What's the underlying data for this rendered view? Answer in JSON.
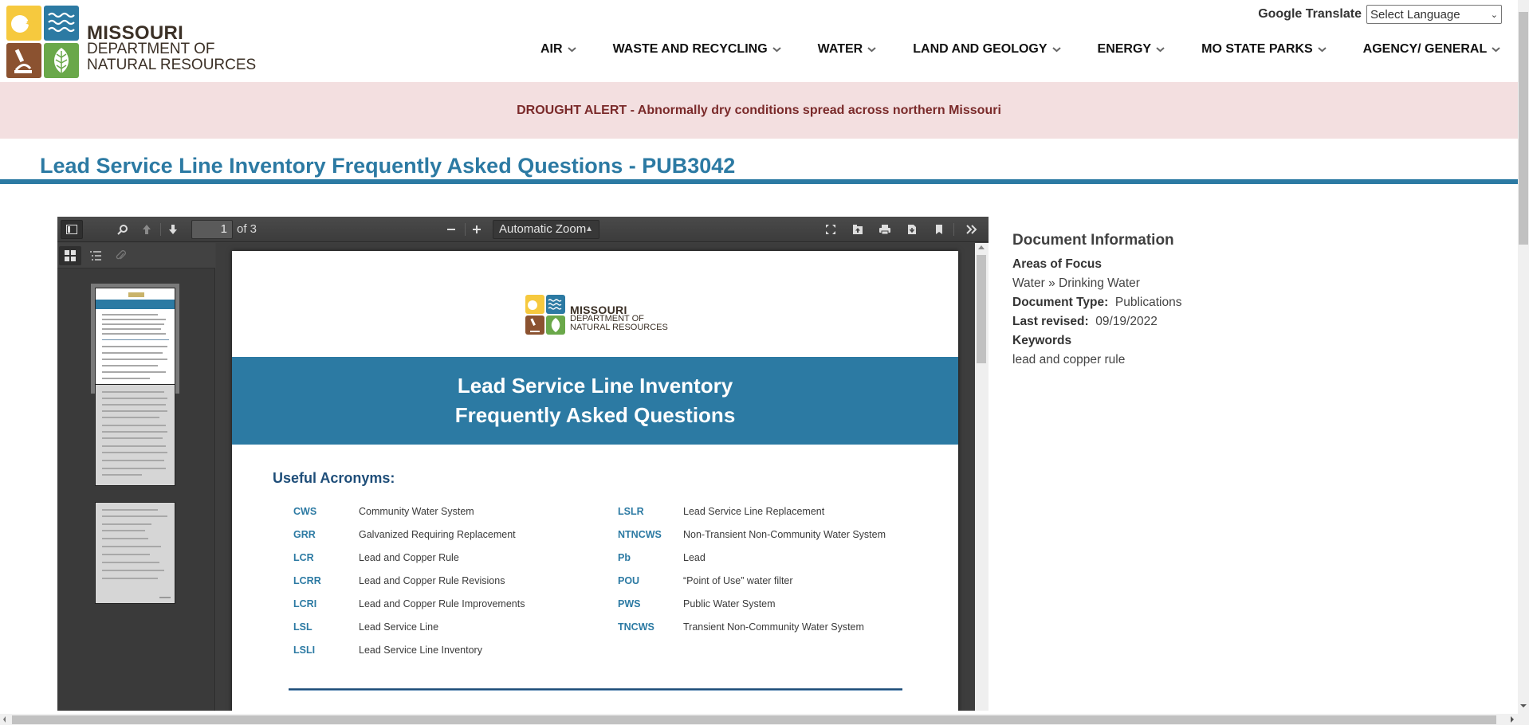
{
  "header": {
    "logo": {
      "line1": "MISSOURI",
      "line2": "DEPARTMENT OF",
      "line3": "NATURAL RESOURCES"
    },
    "translate": {
      "label": "Google Translate",
      "selected": "Select Language"
    },
    "nav": [
      {
        "label": "AIR"
      },
      {
        "label": "WASTE AND RECYCLING"
      },
      {
        "label": "WATER"
      },
      {
        "label": "LAND AND GEOLOGY"
      },
      {
        "label": "ENERGY"
      },
      {
        "label": "MO STATE PARKS"
      },
      {
        "label": "AGENCY/ GENERAL"
      }
    ]
  },
  "alert": {
    "text": "DROUGHT ALERT - Abnormally dry conditions spread across northern Missouri"
  },
  "page": {
    "title": "Lead Service Line Inventory Frequently Asked Questions - PUB3042"
  },
  "viewer": {
    "current_page": "1",
    "page_count_label": "of 3",
    "zoom": "Automatic Zoom",
    "icons": {
      "sidebar_toggle": "sidebar-toggle-icon",
      "find": "search-icon",
      "previous": "arrow-up-icon",
      "next": "arrow-down-icon",
      "zoom_out": "minus-icon",
      "zoom_in": "plus-icon",
      "presentation": "fullscreen-icon",
      "open": "open-file-icon",
      "print": "print-icon",
      "download": "download-icon",
      "bookmark": "bookmark-icon",
      "tools": "double-chevron-right-icon"
    },
    "sidebar_tabs": [
      "thumbnails-icon",
      "outline-icon",
      "attachments-icon"
    ],
    "thumbnails": [
      {
        "page": 1,
        "selected": true
      },
      {
        "page": 2,
        "selected": false
      },
      {
        "page": 3,
        "selected": false
      }
    ],
    "pdf": {
      "logo": {
        "line1": "MISSOURI",
        "line2": "DEPARTMENT OF",
        "line3": "NATURAL RESOURCES"
      },
      "banner_line1": "Lead Service Line Inventory",
      "banner_line2": "Frequently Asked Questions",
      "acronyms_heading": "Useful Acronyms:",
      "acronyms_left": [
        {
          "abbr": "CWS",
          "def": "Community Water System"
        },
        {
          "abbr": "GRR",
          "def": "Galvanized Requiring Replacement"
        },
        {
          "abbr": "LCR",
          "def": "Lead and Copper Rule"
        },
        {
          "abbr": "LCRR",
          "def": "Lead and Copper Rule Revisions"
        },
        {
          "abbr": "LCRI",
          "def": "Lead and Copper Rule Improvements"
        },
        {
          "abbr": "LSL",
          "def": "Lead Service Line"
        },
        {
          "abbr": "LSLI",
          "def": "Lead Service Line Inventory"
        }
      ],
      "acronyms_right": [
        {
          "abbr": "LSLR",
          "def": "Lead Service Line Replacement"
        },
        {
          "abbr": "NTNCWS",
          "def": "Non-Transient Non-Community Water System"
        },
        {
          "abbr": "Pb",
          "def": "Lead"
        },
        {
          "abbr": "POU",
          "def": "“Point of Use” water filter"
        },
        {
          "abbr": "PWS",
          "def": "Public Water System"
        },
        {
          "abbr": "TNCWS",
          "def": "Transient Non-Community Water System"
        }
      ]
    }
  },
  "docinfo": {
    "heading": "Document Information",
    "areas_label": "Areas of Focus",
    "areas_value": "Water » Drinking Water",
    "type_label": "Document Type:",
    "type_value": "Publications",
    "revised_label": "Last revised:",
    "revised_value": "09/19/2022",
    "keywords_label": "Keywords",
    "keywords_value": "lead and copper rule"
  },
  "colors": {
    "brand_blue": "#2c7aa3",
    "alert_bg": "#f3dfe0",
    "alert_text": "#7a2a2a",
    "viewer_dark": "#404040"
  }
}
